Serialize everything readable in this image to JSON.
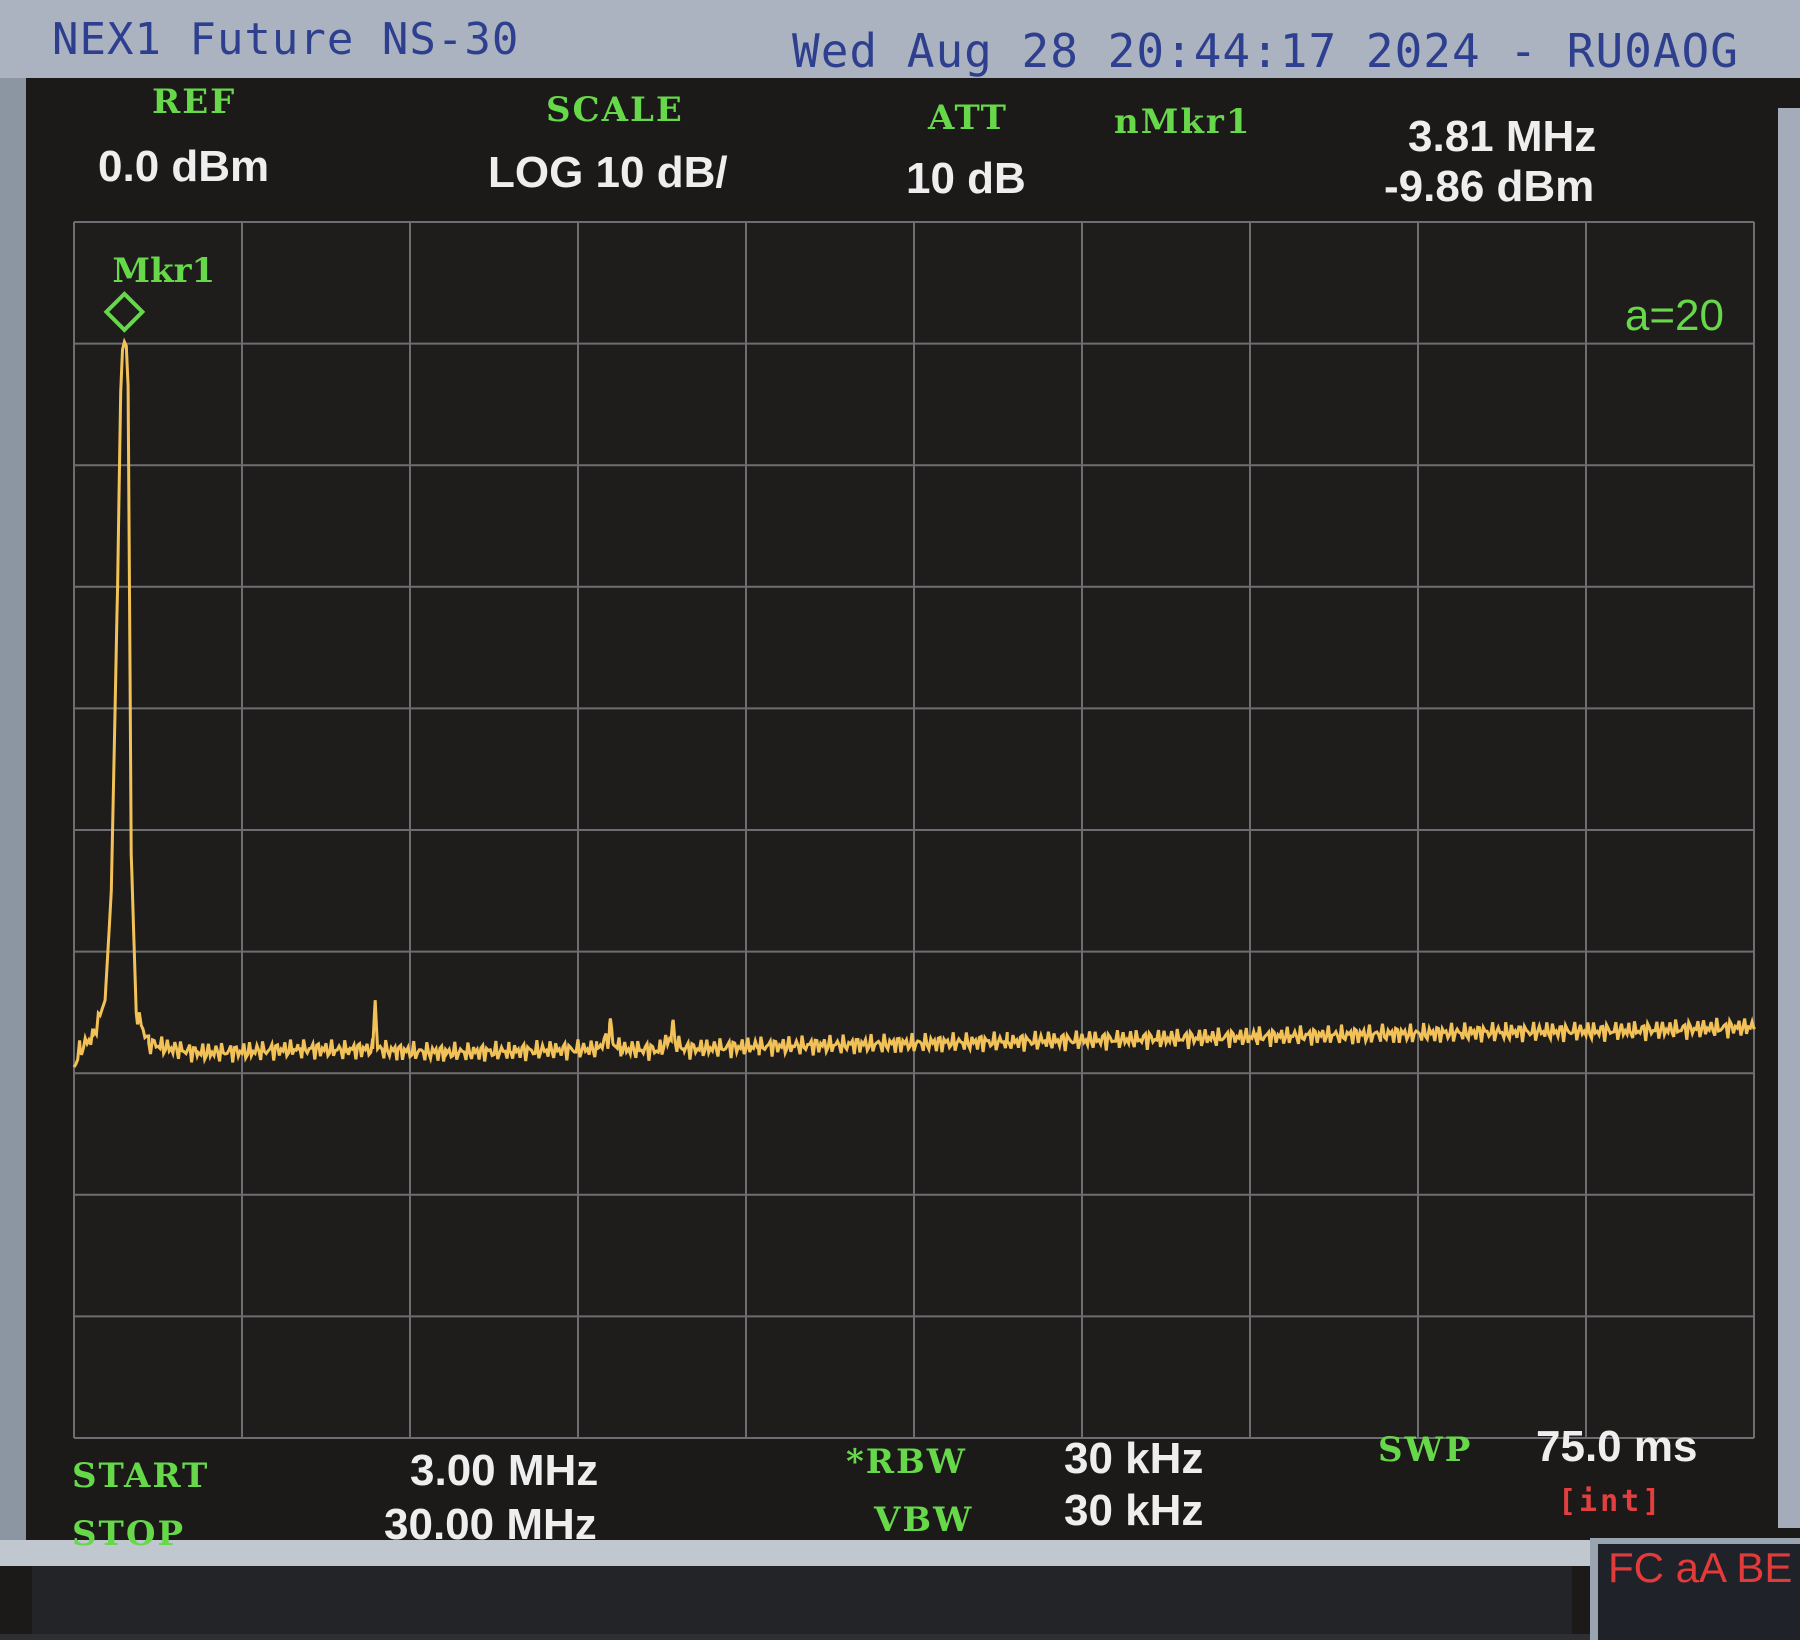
{
  "window": {
    "title": "NEX1 Future NS-30",
    "timestamp": "Wed Aug 28 20:44:17 2024 - RU0AOG"
  },
  "header": {
    "ref_label": "REF",
    "ref_value": "0.0 dBm",
    "scale_label": "SCALE",
    "scale_value": "LOG 10 dB/",
    "att_label": "ATT",
    "att_value": "10 dB",
    "marker_label": "nMkr1",
    "marker_freq": "3.81 MHz",
    "marker_level": "-9.86 dBm"
  },
  "plot": {
    "marker_tag": "Mkr1",
    "average_label": "a=20"
  },
  "footer": {
    "start_label": "START",
    "start_value": "3.00 MHz",
    "stop_label": "STOP",
    "stop_value": "30.00 MHz",
    "rbw_label": "*RBW",
    "rbw_value": "30 kHz",
    "vbw_label": "VBW",
    "vbw_value": "30 kHz",
    "swp_label": "SWP",
    "swp_value": "75.0 ms",
    "swp_mode": "[int]",
    "flags": "FC aA BE"
  },
  "colors": {
    "trace": "#f2c258",
    "grid": "#6c6e72",
    "label_green": "#66d84a",
    "value_white": "#eeeeee",
    "flag_red": "#e33a3a"
  },
  "chart_data": {
    "type": "line",
    "x_unit": "MHz",
    "y_unit": "dBm",
    "xlim": [
      3.0,
      30.0
    ],
    "ylim": [
      -100,
      0
    ],
    "grid": true,
    "x_divisions": 10,
    "y_divisions": 10,
    "noise_floor_dbm": -69,
    "x": [
      3.0,
      3.1,
      3.3,
      3.5,
      3.6,
      3.7,
      3.75,
      3.78,
      3.81,
      3.84,
      3.87,
      3.92,
      4.0,
      4.2,
      4.6,
      5.0,
      5.8,
      6.6,
      7.4,
      7.8,
      7.84,
      7.88,
      8.2,
      9.0,
      10.0,
      11.4,
      11.6,
      11.62,
      11.66,
      11.8,
      12.4,
      12.6,
      12.62,
      12.66,
      12.8,
      14.0,
      16.0,
      18.0,
      20.0,
      22.0,
      24.0,
      26.0,
      28.0,
      30.0
    ],
    "y": [
      -69.5,
      -68.0,
      -67.0,
      -64.0,
      -55.0,
      -30.0,
      -14.0,
      -10.5,
      -9.86,
      -10.2,
      -13.5,
      -52.0,
      -65.0,
      -67.5,
      -68.0,
      -68.3,
      -68.2,
      -68.0,
      -68.1,
      -68.0,
      -64.0,
      -68.0,
      -68.2,
      -68.3,
      -68.2,
      -68.0,
      -67.0,
      -65.5,
      -67.5,
      -68.0,
      -68.1,
      -67.0,
      -65.8,
      -67.4,
      -68.0,
      -67.8,
      -67.6,
      -67.4,
      -67.2,
      -67.0,
      -66.8,
      -66.6,
      -66.5,
      -66.2
    ],
    "markers": [
      {
        "name": "Mkr1",
        "x": 3.81,
        "y": -9.86
      }
    ]
  }
}
